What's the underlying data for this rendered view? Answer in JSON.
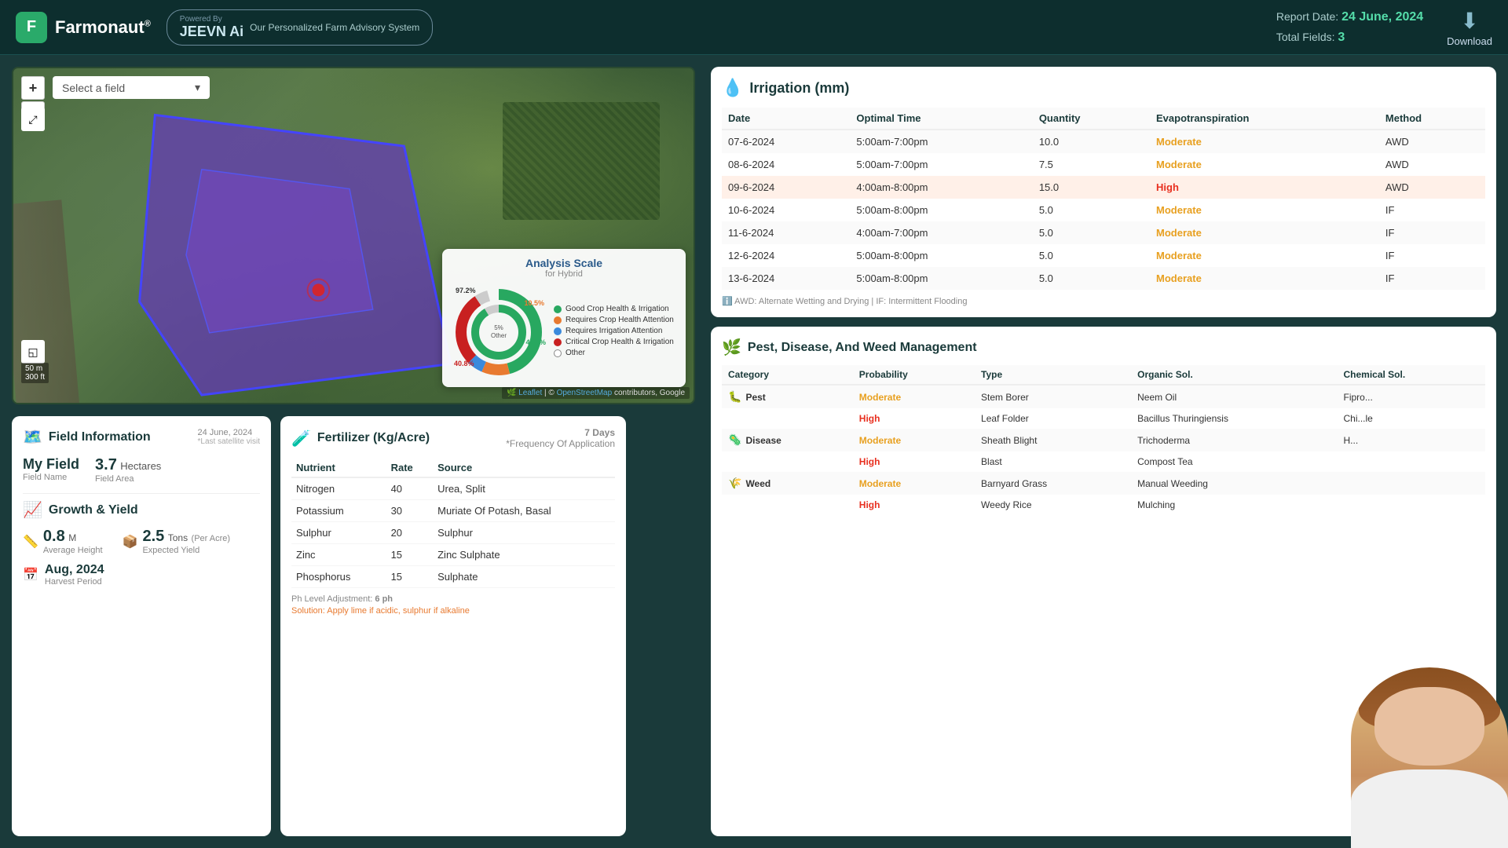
{
  "header": {
    "logo_text": "Farmonaut",
    "logo_reg": "®",
    "jeevn_name": "JEEVN Ai",
    "powered_by": "Powered By",
    "advisory_text": "Our Personalized Farm Advisory System",
    "download_label": "Download",
    "report_date_label": "Report Date:",
    "report_date": "24 June, 2024",
    "total_fields_label": "Total Fields:",
    "total_fields": "3"
  },
  "map": {
    "field_select_placeholder": "Select a field",
    "zoom_in": "+",
    "zoom_out": "−",
    "scale_m": "50 m",
    "scale_ft": "300 ft",
    "attribution": "Leaflet | © OpenStreetMap contributors, Google"
  },
  "analysis_scale": {
    "title": "Analysis Scale",
    "subtitle": "for Hybrid",
    "percent_97": "97.2%",
    "percent_105": "10.5%",
    "percent_458": "45.8%",
    "percent_5": "5%",
    "percent_408": "40.8%",
    "center_label": "5%\nOther",
    "legend": [
      {
        "color": "#28a860",
        "label": "Good Crop Health & Irrigation"
      },
      {
        "color": "#e87a30",
        "label": "Requires Crop Health Attention"
      },
      {
        "color": "#3a8adc",
        "label": "Requires Irrigation Attention"
      },
      {
        "color": "#c82020",
        "label": "Critical Crop Health & Irrigation"
      },
      {
        "color": "#ffffff",
        "label": "Other",
        "border": "#888"
      }
    ]
  },
  "irrigation": {
    "title": "Irrigation (mm)",
    "icon": "💧",
    "columns": [
      "Date",
      "Optimal Time",
      "Quantity",
      "Evapotranspiration",
      "Method"
    ],
    "rows": [
      {
        "date": "07-6-2024",
        "time": "5:00am-7:00pm",
        "qty": "10.0",
        "evap": "Moderate",
        "method": "AWD",
        "highlight": false
      },
      {
        "date": "08-6-2024",
        "time": "5:00am-7:00pm",
        "qty": "7.5",
        "evap": "Moderate",
        "method": "AWD",
        "highlight": false
      },
      {
        "date": "09-6-2024",
        "time": "4:00am-8:00pm",
        "qty": "15.0",
        "evap": "High",
        "method": "AWD",
        "highlight": true
      },
      {
        "date": "10-6-2024",
        "time": "5:00am-8:00pm",
        "qty": "5.0",
        "evap": "Moderate",
        "method": "IF",
        "highlight": false
      },
      {
        "date": "11-6-2024",
        "time": "4:00am-7:00pm",
        "qty": "5.0",
        "evap": "Moderate",
        "method": "IF",
        "highlight": false
      },
      {
        "date": "12-6-2024",
        "time": "5:00am-8:00pm",
        "qty": "5.0",
        "evap": "Moderate",
        "method": "IF",
        "highlight": false
      },
      {
        "date": "13-6-2024",
        "time": "5:00am-8:00pm",
        "qty": "5.0",
        "evap": "Moderate",
        "method": "IF",
        "highlight": false
      }
    ],
    "note": "AWD: Alternate Wetting and Drying | IF: Intermittent Flooding"
  },
  "field_info": {
    "title": "Field Information",
    "icon": "🗺️",
    "date": "24 June, 2024",
    "date_note": "*Last satellite visit",
    "field_name": "My Field",
    "field_name_label": "Field Name",
    "area_value": "3.7",
    "area_unit": "Hectares",
    "area_label": "Field Area"
  },
  "growth": {
    "title": "Growth & Yield",
    "icon": "📈",
    "height_value": "0.8",
    "height_unit": "M",
    "height_label": "Average Height",
    "yield_value": "2.5",
    "yield_unit": "Tons",
    "yield_per": "(Per Acre)",
    "yield_label": "Expected Yield",
    "harvest_date": "Aug, 2024",
    "harvest_label": "Harvest Period"
  },
  "fertilizer": {
    "title": "Fertilizer (Kg/Acre)",
    "icon": "🧪",
    "days": "7 Days",
    "freq_label": "*Frequency Of Application",
    "columns": [
      "Nutrient",
      "Rate",
      "Source"
    ],
    "rows": [
      {
        "nutrient": "Nitrogen",
        "rate": "40",
        "source": "Urea, Split"
      },
      {
        "nutrient": "Potassium",
        "rate": "30",
        "source": "Muriate Of Potash, Basal"
      },
      {
        "nutrient": "Sulphur",
        "rate": "20",
        "source": "Sulphur"
      },
      {
        "nutrient": "Zinc",
        "rate": "15",
        "source": "Zinc Sulphate"
      },
      {
        "nutrient": "Phosphorus",
        "rate": "15",
        "source": "Sulphate"
      }
    ],
    "ph_label": "Ph Level Adjustment:",
    "ph_value": "6 ph",
    "solution_label": "Solution:",
    "solution_text": "Apply lime if acidic, sulphur if alkaline"
  },
  "pest": {
    "title": "Pest, Disease, And Weed Management",
    "icon": "🌿",
    "columns": [
      "Category",
      "Probability",
      "Type",
      "Organic Sol.",
      "Chemical Sol."
    ],
    "rows": [
      {
        "category": "Pest",
        "cat_icon": "🐛",
        "prob": "Moderate",
        "prob_status": "moderate",
        "type": "Stem Borer",
        "organic": "Neem Oil",
        "chemical": "Fipro..."
      },
      {
        "category": "",
        "cat_icon": "",
        "prob": "High",
        "prob_status": "high",
        "type": "Leaf Folder",
        "organic": "Bacillus Thuringiensis",
        "chemical": "Chi...le"
      },
      {
        "category": "Disease",
        "cat_icon": "🦠",
        "prob": "Moderate",
        "prob_status": "moderate",
        "type": "Sheath Blight",
        "organic": "Trichoderma",
        "chemical": "H..."
      },
      {
        "category": "",
        "cat_icon": "",
        "prob": "High",
        "prob_status": "high",
        "type": "Blast",
        "organic": "Compost Tea",
        "chemical": ""
      },
      {
        "category": "Weed",
        "cat_icon": "🌾",
        "prob": "Moderate",
        "prob_status": "moderate",
        "type": "Barnyard Grass",
        "organic": "Manual Weeding",
        "chemical": ""
      },
      {
        "category": "",
        "cat_icon": "",
        "prob": "High",
        "prob_status": "high",
        "type": "Weedy Rice",
        "organic": "Mulching",
        "chemical": ""
      }
    ]
  }
}
